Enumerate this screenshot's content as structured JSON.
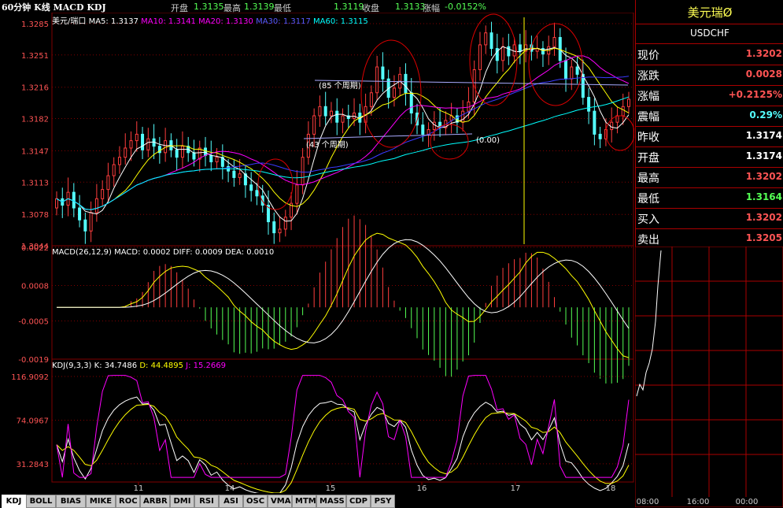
{
  "header": {
    "title": "60分钟 K线 MACD KDJ",
    "stats": [
      {
        "label": "开盘",
        "value": "1.3135"
      },
      {
        "label": "最高",
        "value": "1.3139"
      },
      {
        "label": "最低",
        "value": "1.3119"
      },
      {
        "label": "收盘",
        "value": "1.3133"
      },
      {
        "label": "涨幅",
        "value": "-0.0152%"
      }
    ]
  },
  "colors": {
    "up": "#ff3d3d",
    "down": "#54ffff",
    "ma5": "#ffffff",
    "ma10": "#ffff00",
    "ma20": "#ff00ff",
    "ma30": "#3a3aff",
    "ma60": "#00ffff",
    "grid": "#800000"
  },
  "chart_data": [
    {
      "type": "candlestick",
      "title": "美元/瑞口",
      "legend": [
        {
          "name": "MA5",
          "value": "1.3137"
        },
        {
          "name": "MA10",
          "value": "1.3141"
        },
        {
          "name": "MA20",
          "value": "1.3130"
        },
        {
          "name": "MA30",
          "value": "1.3117"
        },
        {
          "name": "MA60",
          "value": "1.3115"
        }
      ],
      "ytick_labels": [
        "1.3285",
        "1.3251",
        "1.3216",
        "1.3182",
        "1.3147",
        "1.3113",
        "1.3078",
        "1.3044"
      ],
      "ylim": [
        1.3044,
        1.3285
      ],
      "xtick_labels": [
        "11",
        "14",
        "15",
        "16",
        "17",
        "18"
      ],
      "annotations": [
        "(85 个周期)",
        "(43 个周期)",
        "(0.00)"
      ],
      "closes": [
        1.3095,
        1.3088,
        1.3102,
        1.3085,
        1.3072,
        1.306,
        1.308,
        1.3095,
        1.3105,
        1.312,
        1.3132,
        1.314,
        1.315,
        1.3158,
        1.3165,
        1.3148,
        1.316,
        1.3152,
        1.3145,
        1.3158,
        1.3148,
        1.314,
        1.3152,
        1.3145,
        1.3138,
        1.315,
        1.3142,
        1.3135,
        1.314,
        1.313,
        1.3125,
        1.3118,
        1.3122,
        1.311,
        1.3104,
        1.3098,
        1.3088,
        1.307,
        1.3058,
        1.3062,
        1.3075,
        1.309,
        1.311,
        1.314,
        1.3165,
        1.3185,
        1.3195,
        1.3185,
        1.319,
        1.3178,
        1.3185,
        1.3182,
        1.3188,
        1.3178,
        1.3195,
        1.321,
        1.3238,
        1.3225,
        1.3205,
        1.3215,
        1.323,
        1.321,
        1.3188,
        1.3175,
        1.3165,
        1.317,
        1.3178,
        1.3172,
        1.318,
        1.3185,
        1.3178,
        1.319,
        1.32,
        1.3235,
        1.3262,
        1.3275,
        1.3258,
        1.3245,
        1.326,
        1.325,
        1.3262,
        1.3255,
        1.3262,
        1.3255,
        1.3258,
        1.3252,
        1.326,
        1.327,
        1.3245,
        1.3225,
        1.3238,
        1.323,
        1.3205,
        1.319,
        1.3165,
        1.316,
        1.317,
        1.3178,
        1.3185,
        1.3195,
        1.3203
      ]
    },
    {
      "type": "bar",
      "title": "MACD(26,12,9)",
      "legend": [
        {
          "name": "MACD",
          "value": "0.0002"
        },
        {
          "name": "DIFF",
          "value": "0.0009"
        },
        {
          "name": "DEA",
          "value": "0.0010"
        }
      ],
      "ytick_labels": [
        "0.0022",
        "0.0008",
        "-0.0005",
        "-0.0019"
      ],
      "ylim": [
        -0.0019,
        0.0022
      ]
    },
    {
      "type": "line",
      "title": "KDJ(9,3,3)",
      "legend": [
        {
          "name": "K",
          "value": "34.7486"
        },
        {
          "name": "D",
          "value": "44.4895"
        },
        {
          "name": "J",
          "value": "15.2669"
        }
      ],
      "ytick_labels": [
        "116.9092",
        "74.0967",
        "31.2843"
      ],
      "ylim": [
        15.0,
        120.0
      ]
    }
  ],
  "quote": {
    "title": "美元瑞Ø",
    "symbol": "USDCHF",
    "rows": [
      {
        "label": "现价",
        "value": "1.3202",
        "color": "#ff5454"
      },
      {
        "label": "涨跌",
        "value": "0.0028",
        "color": "#ff5454"
      },
      {
        "label": "涨幅",
        "value": "+0.2125%",
        "color": "#ff5454"
      },
      {
        "label": "震幅",
        "value": "0.29%",
        "color": "#54ffff"
      },
      {
        "label": "昨收",
        "value": "1.3174",
        "color": "#ffffff"
      },
      {
        "label": "开盘",
        "value": "1.3174",
        "color": "#ffffff"
      },
      {
        "label": "最高",
        "value": "1.3202",
        "color": "#ff5454"
      },
      {
        "label": "最低",
        "value": "1.3164",
        "color": "#54ff54"
      },
      {
        "label": "买入",
        "value": "1.3202",
        "color": "#ff5454"
      },
      {
        "label": "卖出",
        "value": "1.3205",
        "color": "#ff5454"
      }
    ],
    "intraday_times": [
      "08:00",
      "16:00",
      "00:00"
    ]
  },
  "tabs": [
    "KDJ",
    "BOLL",
    "BIAS",
    "MIKE",
    "ROC",
    "ARBR",
    "DMI",
    "RSI",
    "ASI",
    "OSC",
    "VMA",
    "MTM",
    "MASS",
    "CDP",
    "PSY"
  ]
}
